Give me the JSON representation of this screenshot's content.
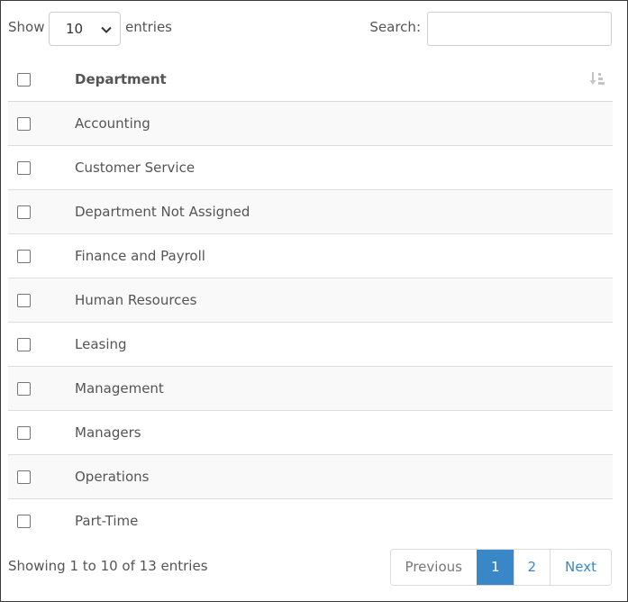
{
  "top": {
    "show_label": "Show",
    "page_length": "10",
    "entries_label": "entries",
    "search_label": "Search:",
    "search_value": ""
  },
  "table": {
    "header": "Department",
    "rows": [
      "Accounting",
      "Customer Service",
      "Department Not Assigned",
      "Finance and Payroll",
      "Human Resources",
      "Leasing",
      "Management",
      "Managers",
      "Operations",
      "Part-Time"
    ]
  },
  "footer": {
    "info": "Showing 1 to 10 of 13 entries",
    "pagination": {
      "previous": "Previous",
      "pages": [
        "1",
        "2"
      ],
      "current": "1",
      "next": "Next"
    }
  },
  "colors": {
    "accent": "#3a87c8",
    "stripe": "#f9f9f9"
  }
}
